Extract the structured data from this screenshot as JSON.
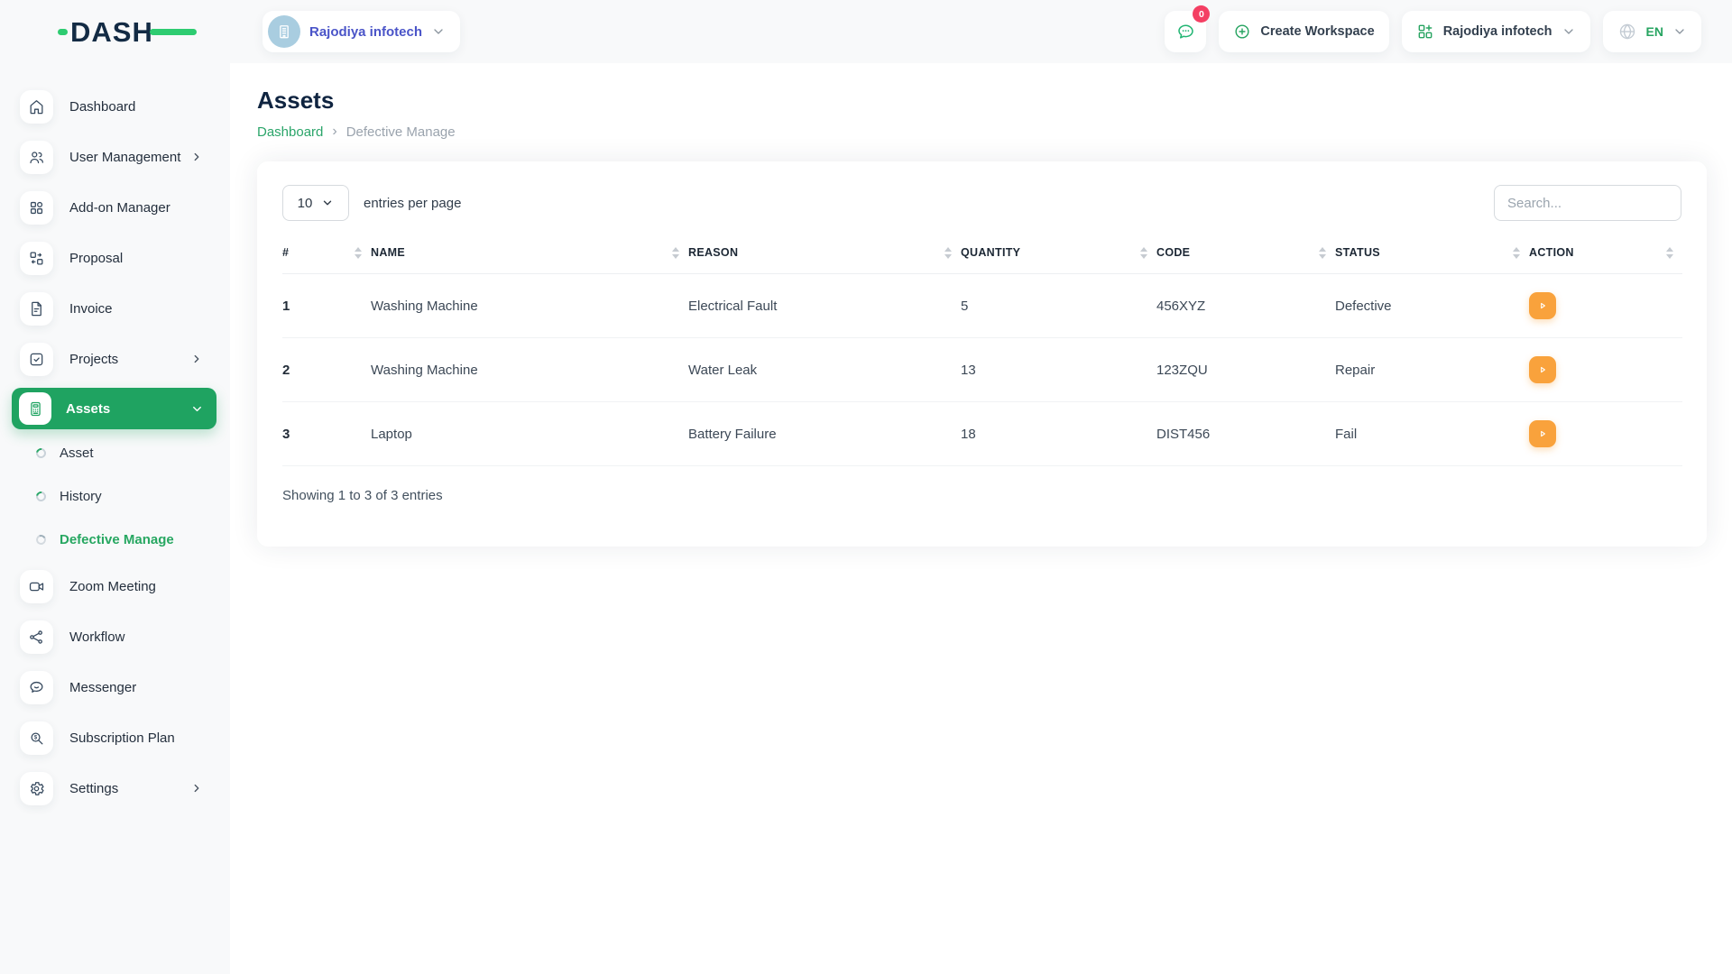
{
  "brand": {
    "logo_text": "DASH"
  },
  "topbar": {
    "workspace_pill_label": "Rajodiya infotech",
    "notification_badge": "0",
    "create_workspace_label": "Create Workspace",
    "workspace_dropdown_label": "Rajodiya infotech",
    "language_label": "EN"
  },
  "sidebar": {
    "items": [
      {
        "label": "Dashboard",
        "icon": "home-icon"
      },
      {
        "label": "User Management",
        "icon": "users-icon"
      },
      {
        "label": "Add-on Manager",
        "icon": "grid-icon"
      },
      {
        "label": "Proposal",
        "icon": "swap-icon"
      },
      {
        "label": "Invoice",
        "icon": "invoice-icon"
      },
      {
        "label": "Projects",
        "icon": "check-square-icon"
      },
      {
        "label": "Assets",
        "icon": "calculator-icon",
        "active": true
      }
    ],
    "assets_children": [
      {
        "label": "Asset"
      },
      {
        "label": "History"
      },
      {
        "label": "Defective Manage",
        "active": true
      }
    ],
    "items2": [
      {
        "label": "Zoom Meeting",
        "icon": "video-icon"
      },
      {
        "label": "Workflow",
        "icon": "share-icon"
      },
      {
        "label": "Messenger",
        "icon": "chat-icon"
      },
      {
        "label": "Subscription Plan",
        "icon": "search-dollar-icon"
      },
      {
        "label": "Settings",
        "icon": "gear-icon"
      }
    ]
  },
  "page": {
    "title": "Assets",
    "breadcrumb": {
      "home": "Dashboard",
      "current": "Defective Manage"
    }
  },
  "toolbar": {
    "entries_value": "10",
    "entries_label": "entries per page",
    "search_placeholder": "Search..."
  },
  "table": {
    "headers": [
      "#",
      "NAME",
      "REASON",
      "QUANTITY",
      "CODE",
      "STATUS",
      "ACTION"
    ],
    "rows": [
      {
        "num": "1",
        "name": "Washing Machine",
        "reason": "Electrical Fault",
        "quantity": "5",
        "code": "456XYZ",
        "status": "Defective"
      },
      {
        "num": "2",
        "name": "Washing Machine",
        "reason": "Water Leak",
        "quantity": "13",
        "code": "123ZQU",
        "status": "Repair"
      },
      {
        "num": "3",
        "name": "Laptop",
        "reason": "Battery Failure",
        "quantity": "18",
        "code": "DIST456",
        "status": "Fail"
      }
    ],
    "footer": "Showing 1 to 3 of 3 entries"
  },
  "colors": {
    "accent_green": "#1fa361",
    "logo_green": "#2ecc71",
    "action_orange": "#f9a23c",
    "badge_pink": "#f43f63",
    "navy": "#132b44",
    "workspace_blue": "#4a54c8"
  }
}
